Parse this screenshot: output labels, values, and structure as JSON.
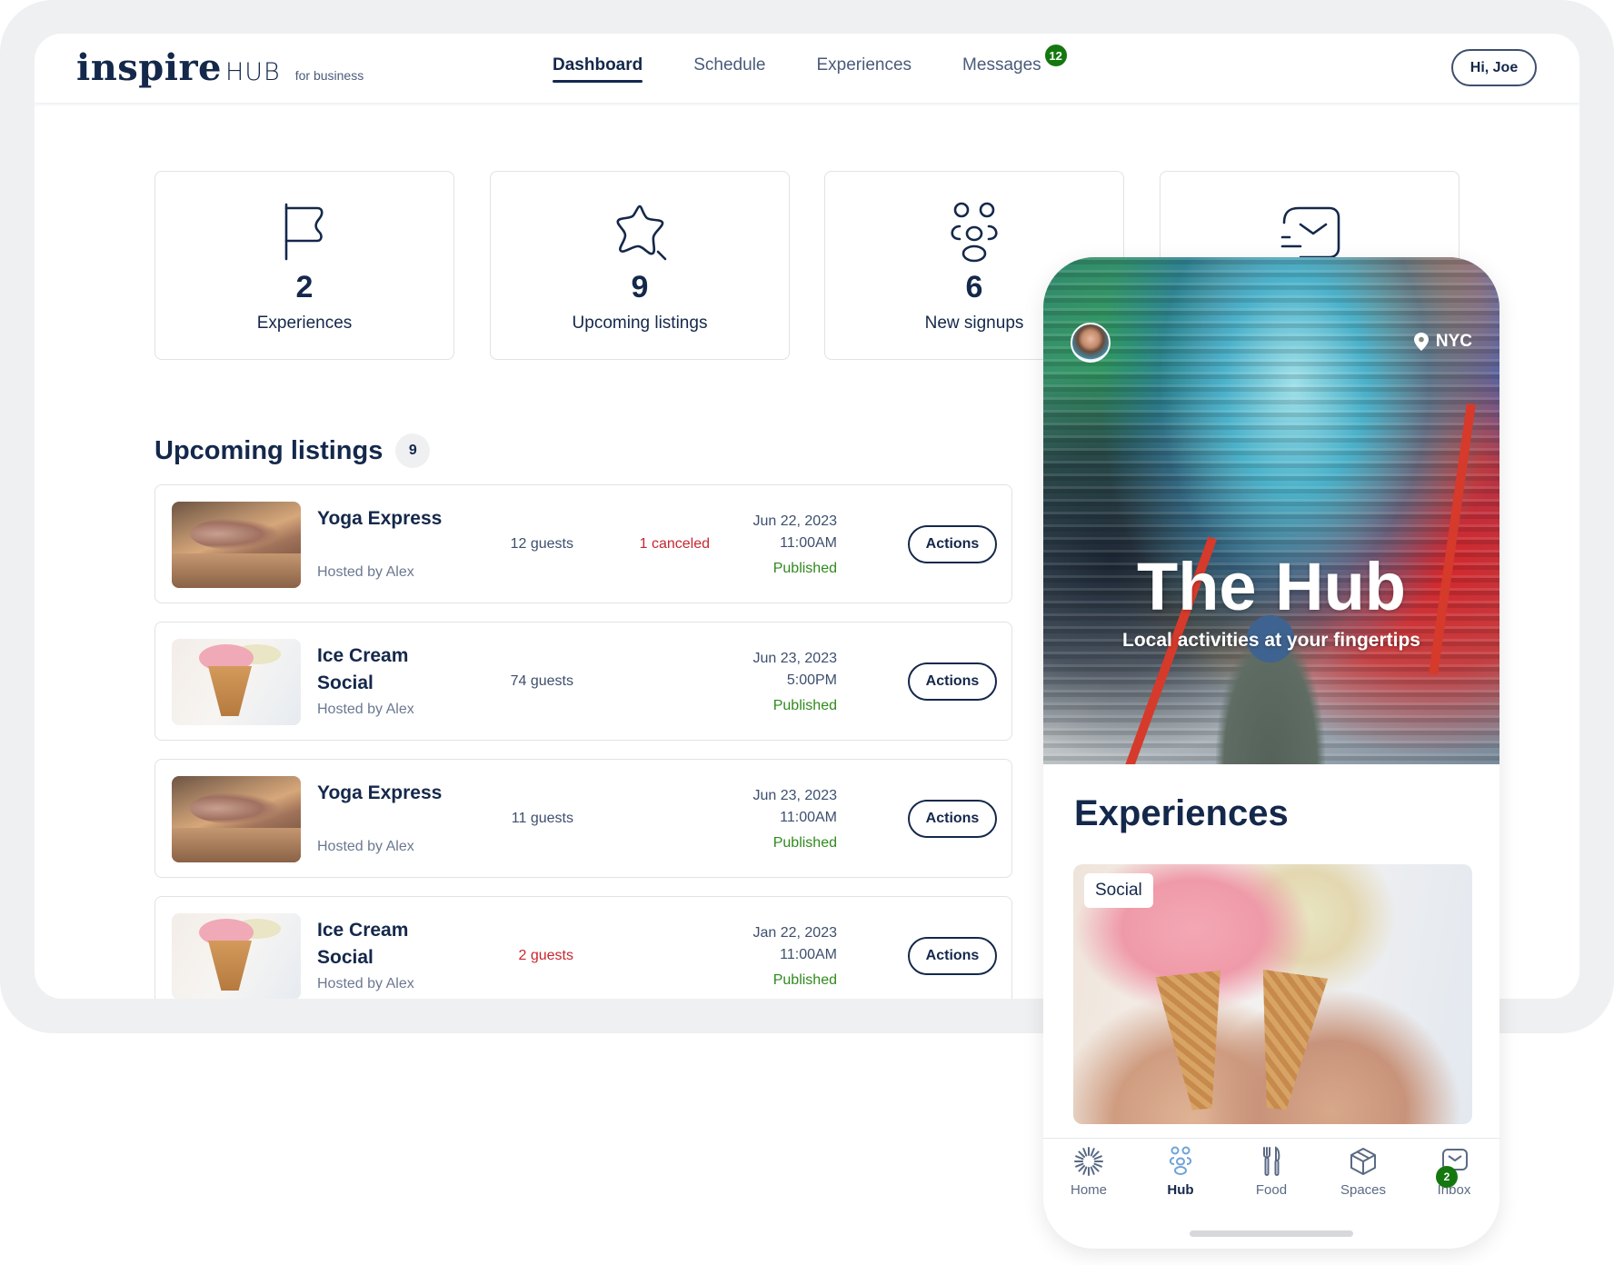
{
  "brand": {
    "name": "inspire",
    "product": "HUB",
    "tagline": "for business"
  },
  "nav": {
    "items": [
      {
        "label": "Dashboard",
        "active": true
      },
      {
        "label": "Schedule",
        "active": false
      },
      {
        "label": "Experiences",
        "active": false
      },
      {
        "label": "Messages",
        "active": false,
        "badge": "12"
      }
    ],
    "greeting": "Hi, Joe"
  },
  "stats": [
    {
      "icon": "flag-icon",
      "value": "2",
      "label": "Experiences"
    },
    {
      "icon": "star-wand-icon",
      "value": "9",
      "label": "Upcoming listings"
    },
    {
      "icon": "people-group-icon",
      "value": "6",
      "label": "New signups"
    },
    {
      "icon": "mail-fast-icon",
      "value": "",
      "label": ""
    }
  ],
  "listings": {
    "title": "Upcoming listings",
    "count": "9",
    "rows": [
      {
        "image": "yoga",
        "title": "Yoga Express",
        "host": "Hosted by Alex",
        "guests": "12 guests",
        "guests_warn": false,
        "canceled": "1 canceled",
        "date": "Jun 22, 2023",
        "time": "11:00AM",
        "status": "Published",
        "action": "Actions"
      },
      {
        "image": "icecream",
        "title": "Ice Cream Social",
        "host": "Hosted by Alex",
        "guests": "74 guests",
        "guests_warn": false,
        "canceled": "",
        "date": "Jun 23, 2023",
        "time": "5:00PM",
        "status": "Published",
        "action": "Actions"
      },
      {
        "image": "yoga",
        "title": "Yoga Express",
        "host": "Hosted by Alex",
        "guests": "11 guests",
        "guests_warn": false,
        "canceled": "",
        "date": "Jun 23, 2023",
        "time": "11:00AM",
        "status": "Published",
        "action": "Actions"
      },
      {
        "image": "icecream",
        "title": "Ice Cream Social",
        "host": "Hosted by Alex",
        "guests": "2 guests",
        "guests_warn": true,
        "canceled": "",
        "date": "Jan 22, 2023",
        "time": "11:00AM",
        "status": "Published",
        "action": "Actions"
      }
    ]
  },
  "phone": {
    "location": "NYC",
    "hero_title": "The Hub",
    "hero_subtitle": "Local activities at your fingertips",
    "section_title": "Experiences",
    "card_tag": "Social",
    "tabs": [
      {
        "label": "Home",
        "icon": "sunburst-icon",
        "active": false
      },
      {
        "label": "Hub",
        "icon": "people-group-icon",
        "active": true
      },
      {
        "label": "Food",
        "icon": "fork-knife-icon",
        "active": false
      },
      {
        "label": "Spaces",
        "icon": "cube-icon",
        "active": false
      },
      {
        "label": "Inbox",
        "icon": "mail-icon",
        "active": false,
        "badge": "2"
      }
    ]
  },
  "colors": {
    "brand_navy": "#14284b",
    "badge_green": "#15780f",
    "status_published": "#2f8a1c",
    "warning_red": "#c8262e",
    "frame_gray": "#eff0f2"
  }
}
